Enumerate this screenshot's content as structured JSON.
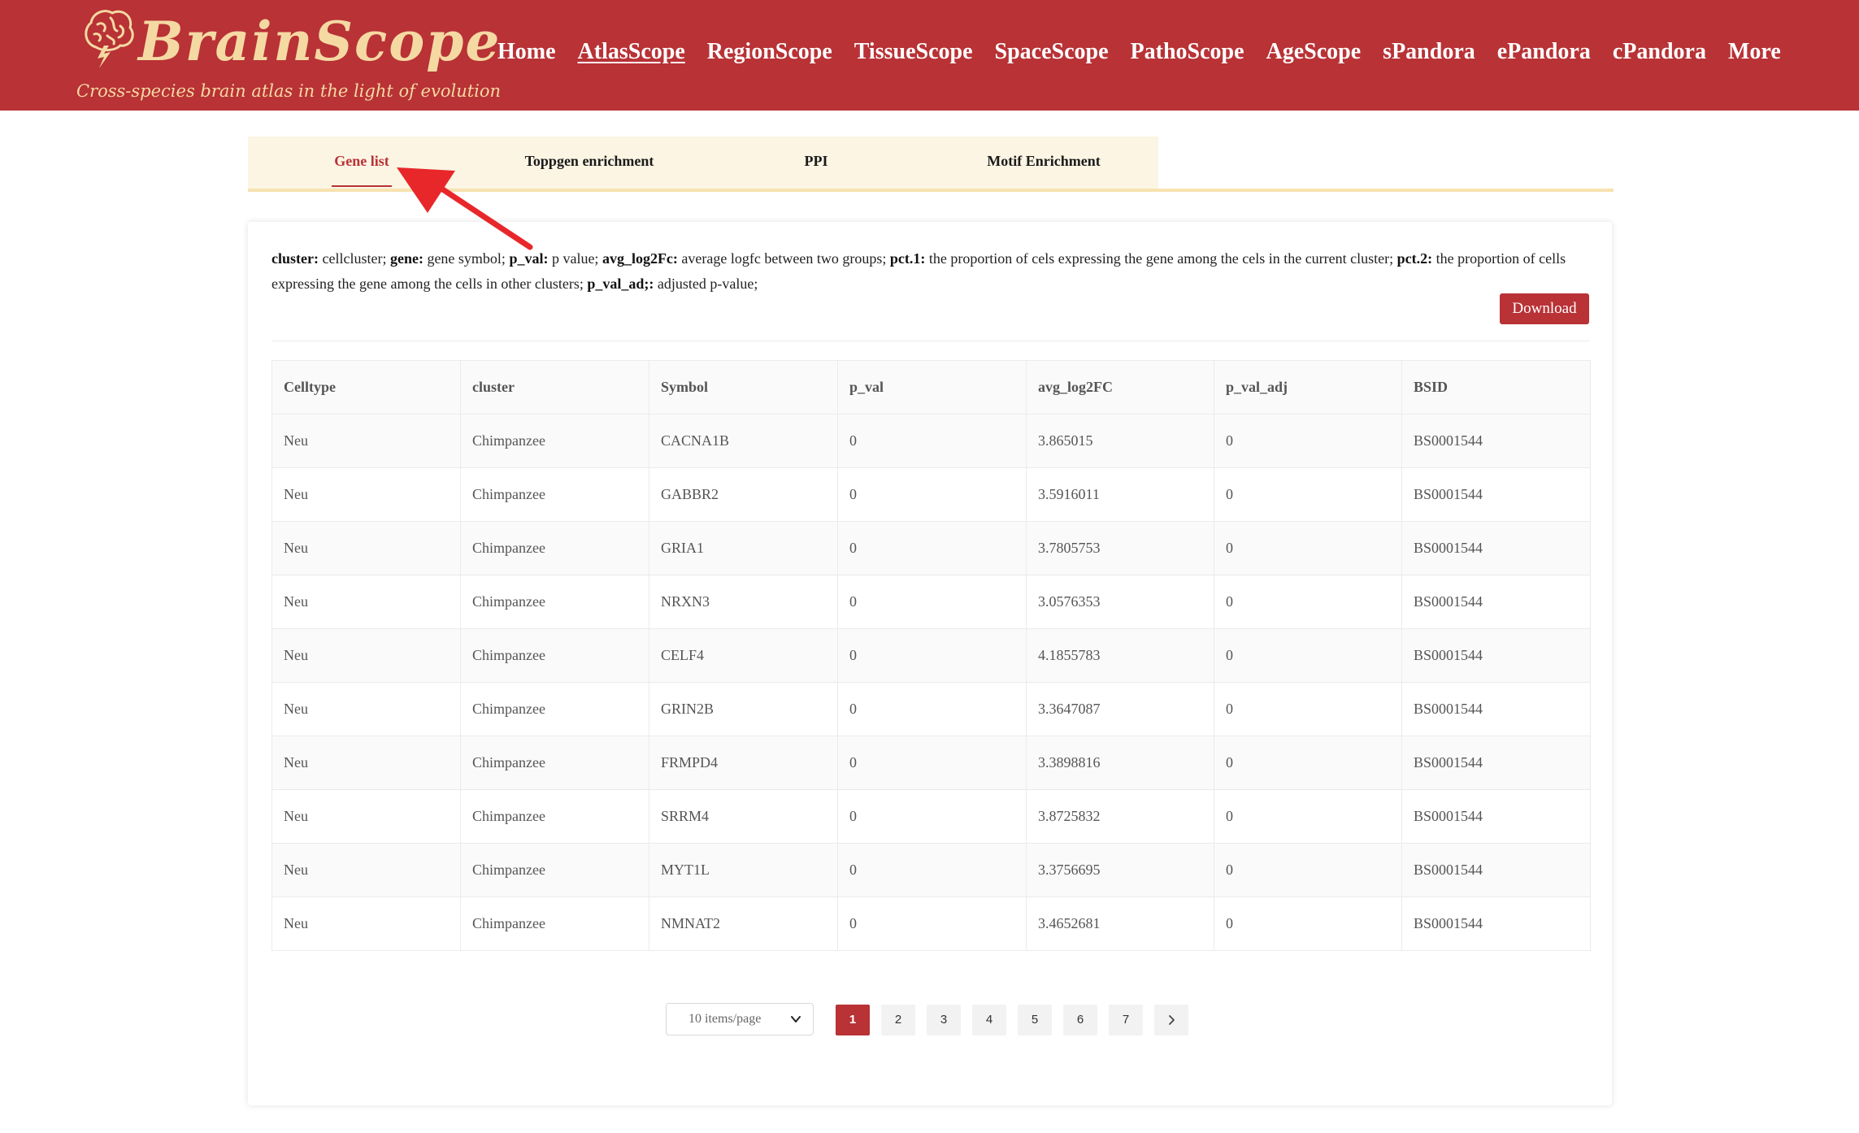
{
  "header": {
    "logo_title": "BrainScope",
    "logo_subtitle": "Cross-species brain atlas in the light of evolution",
    "nav": [
      "Home",
      "AtlasScope",
      "RegionScope",
      "TissueScope",
      "SpaceScope",
      "PathoScope",
      "AgeScope",
      "sPandora",
      "ePandora",
      "cPandora",
      "More"
    ],
    "active_nav": "AtlasScope"
  },
  "tabs": [
    "Gene list",
    "Toppgen enrichment",
    "PPI",
    "Motif Enrichment"
  ],
  "active_tab": "Gene list",
  "description": {
    "items": [
      {
        "key": "cluster:",
        "text": " cellcluster; "
      },
      {
        "key": "gene:",
        "text": " gene symbol; "
      },
      {
        "key": "p_val:",
        "text": " p value; "
      },
      {
        "key": "avg_log2Fc:",
        "text": " average logfc between two groups; "
      },
      {
        "key": "pct.1:",
        "text": " the proportion of cels expressing the gene among the cels in the current cluster; "
      },
      {
        "key": "pct.2:",
        "text": " the proportion of cells expressing the gene among the cells in other clusters; "
      },
      {
        "key": "p_val_ad;:",
        "text": " adjusted p-value;"
      }
    ]
  },
  "download_label": "Download",
  "table": {
    "columns": [
      "Celltype",
      "cluster",
      "Symbol",
      "p_val",
      "avg_log2FC",
      "p_val_adj",
      "BSID"
    ],
    "rows": [
      [
        "Neu",
        "Chimpanzee",
        "CACNA1B",
        "0",
        "3.865015",
        "0",
        "BS0001544"
      ],
      [
        "Neu",
        "Chimpanzee",
        "GABBR2",
        "0",
        "3.5916011",
        "0",
        "BS0001544"
      ],
      [
        "Neu",
        "Chimpanzee",
        "GRIA1",
        "0",
        "3.7805753",
        "0",
        "BS0001544"
      ],
      [
        "Neu",
        "Chimpanzee",
        "NRXN3",
        "0",
        "3.0576353",
        "0",
        "BS0001544"
      ],
      [
        "Neu",
        "Chimpanzee",
        "CELF4",
        "0",
        "4.1855783",
        "0",
        "BS0001544"
      ],
      [
        "Neu",
        "Chimpanzee",
        "GRIN2B",
        "0",
        "3.3647087",
        "0",
        "BS0001544"
      ],
      [
        "Neu",
        "Chimpanzee",
        "FRMPD4",
        "0",
        "3.3898816",
        "0",
        "BS0001544"
      ],
      [
        "Neu",
        "Chimpanzee",
        "SRRM4",
        "0",
        "3.8725832",
        "0",
        "BS0001544"
      ],
      [
        "Neu",
        "Chimpanzee",
        "MYT1L",
        "0",
        "3.3756695",
        "0",
        "BS0001544"
      ],
      [
        "Neu",
        "Chimpanzee",
        "NMNAT2",
        "0",
        "3.4652681",
        "0",
        "BS0001544"
      ]
    ]
  },
  "pagination": {
    "page_size_label": "10 items/page",
    "pages": [
      "1",
      "2",
      "3",
      "4",
      "5",
      "6",
      "7"
    ],
    "current_page": "1",
    "next_icon": "chevron-right-icon"
  },
  "colors": {
    "brand_red": "#b83236",
    "logo_gold": "#f5d9a3",
    "tab_bg": "#fcf5e4",
    "annotation_arrow": "#e8272b"
  }
}
